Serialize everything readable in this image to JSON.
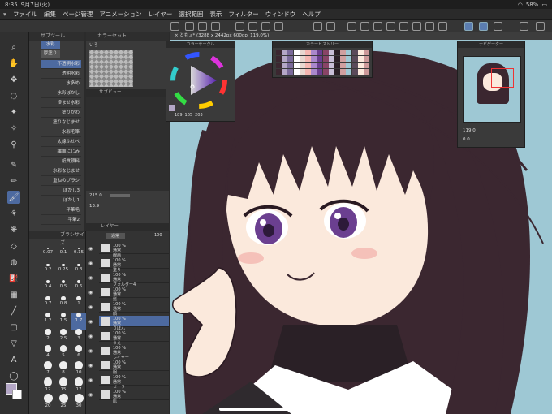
{
  "status": {
    "time": "8:35",
    "date": "9月7日(火)",
    "battery": "58%"
  },
  "menu": [
    "ファイル",
    "編集",
    "ページ管理",
    "アニメーション",
    "レイヤー",
    "選択範囲",
    "表示",
    "フィルター",
    "ウィンドウ",
    "ヘルプ"
  ],
  "panels": {
    "subtool": "サブツール",
    "colorset": "カラーセット",
    "colorset_name": "いろ",
    "colorwheel": "カラーサークル",
    "subview": "サブビュー",
    "colorhistory": "カラーヒストリー",
    "navigator": "ナビゲーター",
    "brushsize": "ブラシサイズ",
    "layer": "レイヤー"
  },
  "document_tab": "とも.a* (3288 x 2442px 600dpi 119.0%)",
  "brush_tabs": [
    "水彩",
    "厚塗り"
  ],
  "brushes": [
    "不透明水彩",
    "透明水彩",
    "水多め",
    "水彩ぼかし",
    "滲ませ水彩",
    "塗りかわ",
    "塗りなじませ",
    "水彩毛筆",
    "太線ふせペ",
    "繊維にじみ",
    "紙質顔料",
    "水彩なじませ",
    "重ねのブラシ",
    "ぼかし3",
    "ぼかし1",
    "平筆毛",
    "平筆2"
  ],
  "color_values": {
    "h": "189",
    "s": "165",
    "v": "203"
  },
  "tool_property": {
    "size": "215.0",
    "opacity": "13.9"
  },
  "navigator": {
    "zoom": "119.0",
    "angle": "0.0"
  },
  "layer_header": {
    "blend": "通常",
    "opacity": "100"
  },
  "layers": [
    {
      "pct": "100 %",
      "blend": "通常",
      "name": "線画"
    },
    {
      "pct": "100 %",
      "blend": "通常",
      "name": "塗り"
    },
    {
      "pct": "100 %",
      "blend": "通常",
      "name": "フォルダー4"
    },
    {
      "pct": "100 %",
      "blend": "通常",
      "name": "髪"
    },
    {
      "pct": "100 %",
      "blend": "通常",
      "name": "顔"
    },
    {
      "pct": "100 %",
      "blend": "通常",
      "name": "りぼん"
    },
    {
      "pct": "100 %",
      "blend": "通常",
      "name": "うえ"
    },
    {
      "pct": "100 %",
      "blend": "通常",
      "name": "レイヤー"
    },
    {
      "pct": "100 %",
      "blend": "通常",
      "name": "服"
    },
    {
      "pct": "100 %",
      "blend": "通常",
      "name": "セーラー"
    },
    {
      "pct": "100 %",
      "blend": "通常",
      "name": "肌"
    }
  ],
  "brush_sizes": [
    "0.07",
    "0.1",
    "0.15",
    "0.2",
    "0.25",
    "0.3",
    "0.4",
    "0.5",
    "0.6",
    "0.7",
    "0.8",
    "1",
    "1.2",
    "1.5",
    "1.7",
    "2",
    "2.5",
    "3",
    "4",
    "5",
    "6",
    "7",
    "8",
    "10",
    "12",
    "15",
    "17",
    "20",
    "25",
    "30"
  ],
  "colors": {
    "canvas_bg": "#9ec8d4",
    "hair": "#3b2730",
    "skin": "#fbe9dc",
    "eye": "#6b3f90",
    "accent": "#4d6aa0"
  }
}
